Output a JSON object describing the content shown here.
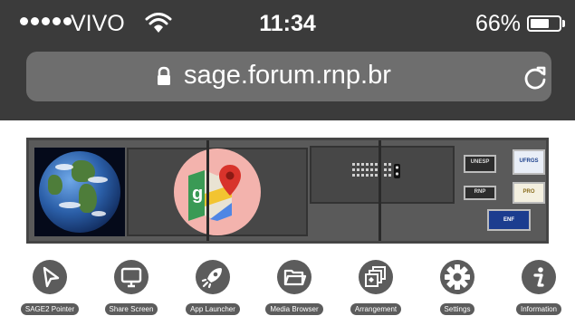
{
  "status_bar": {
    "carrier": "VIVO",
    "time": "11:34",
    "battery_percent": "66%",
    "battery_level": 0.66,
    "signal_dots": 5,
    "icons": [
      "signal-icon",
      "wifi-icon",
      "battery-icon"
    ]
  },
  "address_bar": {
    "url": "sage.forum.rnp.br",
    "icons": [
      "lock-icon",
      "reload-icon"
    ]
  },
  "wall": {
    "apps": [
      "earth-image",
      "google-maps",
      "image-grid",
      "unesp-logo",
      "ufrgs-logo",
      "rnp-logo",
      "pro-logo",
      "enf-logo"
    ],
    "logos": {
      "unesp": "UNESP",
      "ufrgs": "UFRGS",
      "rnp": "RNP",
      "pro": "PRO",
      "enf": "ENF"
    }
  },
  "toolbar": {
    "items": [
      {
        "label": "SAGE2 Pointer",
        "icon": "pointer-icon"
      },
      {
        "label": "Share Screen",
        "icon": "monitor-icon"
      },
      {
        "label": "App Launcher",
        "icon": "rocket-icon"
      },
      {
        "label": "Media Browser",
        "icon": "folder-icon"
      },
      {
        "label": "Arrangement",
        "icon": "stack-icon"
      },
      {
        "label": "Settings",
        "icon": "gear-icon"
      },
      {
        "label": "Information",
        "icon": "info-icon"
      }
    ]
  },
  "colors": {
    "topbar": "#3b3b3b",
    "urlbar": "#6e6e6e",
    "wall": "#5a5a5a",
    "tool": "#5c5c5c"
  }
}
